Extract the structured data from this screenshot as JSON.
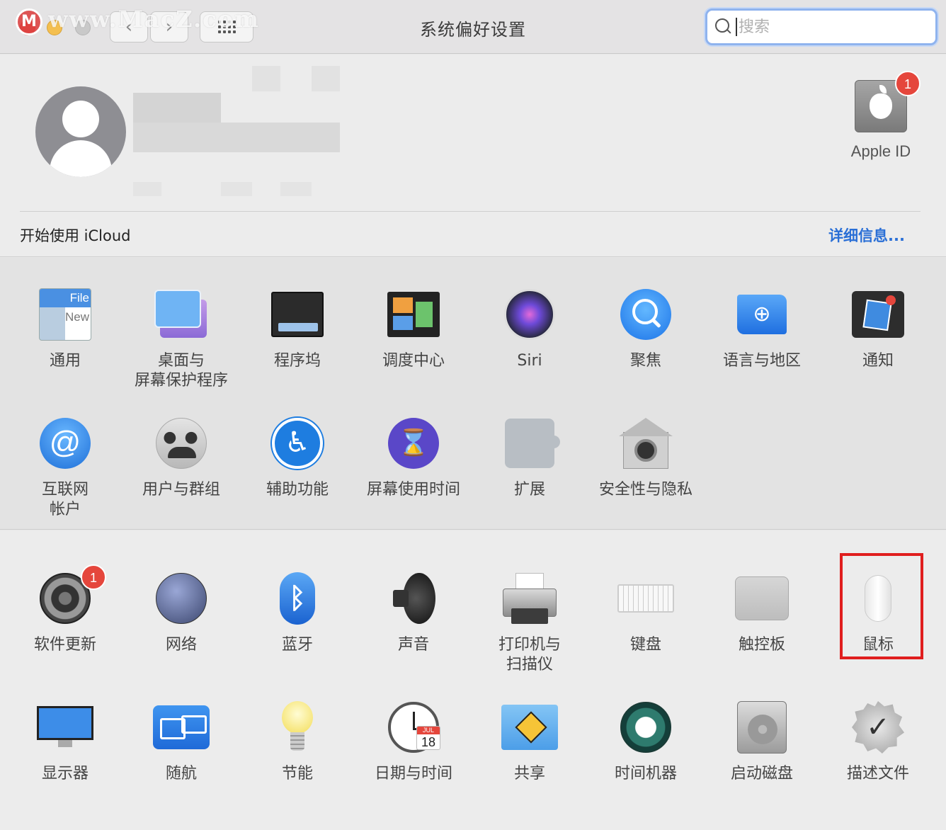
{
  "window": {
    "title": "系统偏好设置",
    "watermark": "www.MacZ.com",
    "watermark_logo": "M"
  },
  "search": {
    "placeholder": "搜索",
    "value": ""
  },
  "account": {
    "apple_id_label": "Apple ID",
    "apple_id_badge": "1",
    "icloud_prompt": "开始使用 iCloud",
    "details_link": "详细信息..."
  },
  "section1": [
    {
      "label": "通用",
      "icon": "general-icon",
      "general_top": "File",
      "general_mid": "New"
    },
    {
      "label": "桌面与\n屏幕保护程序",
      "icon": "desktop-icon"
    },
    {
      "label": "程序坞",
      "icon": "dock-icon"
    },
    {
      "label": "调度中心",
      "icon": "mission-control-icon"
    },
    {
      "label": "Siri",
      "icon": "siri-icon"
    },
    {
      "label": "聚焦",
      "icon": "spotlight-icon"
    },
    {
      "label": "语言与地区",
      "icon": "language-region-icon"
    },
    {
      "label": "通知",
      "icon": "notifications-icon"
    },
    {
      "label": "互联网\n帐户",
      "icon": "internet-accounts-icon",
      "glyph": "@"
    },
    {
      "label": "用户与群组",
      "icon": "users-groups-icon"
    },
    {
      "label": "辅助功能",
      "icon": "accessibility-icon",
      "glyph": "♿"
    },
    {
      "label": "屏幕使用时间",
      "icon": "screen-time-icon",
      "glyph": "⌛"
    },
    {
      "label": "扩展",
      "icon": "extensions-icon"
    },
    {
      "label": "安全性与隐私",
      "icon": "security-privacy-icon"
    }
  ],
  "section2": [
    {
      "label": "软件更新",
      "icon": "software-update-icon",
      "badge": "1"
    },
    {
      "label": "网络",
      "icon": "network-icon"
    },
    {
      "label": "蓝牙",
      "icon": "bluetooth-icon",
      "glyph": "ᛒ"
    },
    {
      "label": "声音",
      "icon": "sound-icon"
    },
    {
      "label": "打印机与\n扫描仪",
      "icon": "printers-scanners-icon"
    },
    {
      "label": "键盘",
      "icon": "keyboard-icon"
    },
    {
      "label": "触控板",
      "icon": "trackpad-icon"
    },
    {
      "label": "鼠标",
      "icon": "mouse-icon",
      "highlighted": true
    },
    {
      "label": "显示器",
      "icon": "displays-icon"
    },
    {
      "label": "随航",
      "icon": "sidecar-icon"
    },
    {
      "label": "节能",
      "icon": "energy-saver-icon"
    },
    {
      "label": "日期与时间",
      "icon": "date-time-icon",
      "cal_month": "JUL",
      "cal_day": "18"
    },
    {
      "label": "共享",
      "icon": "sharing-icon"
    },
    {
      "label": "时间机器",
      "icon": "time-machine-icon"
    },
    {
      "label": "启动磁盘",
      "icon": "startup-disk-icon"
    },
    {
      "label": "描述文件",
      "icon": "profiles-icon",
      "glyph": "✓"
    }
  ],
  "colors": {
    "accent": "#2a6fd6",
    "badge": "#e5463c",
    "highlight_box": "#e01e1e"
  }
}
